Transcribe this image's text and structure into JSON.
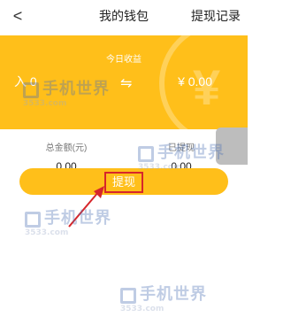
{
  "nav": {
    "back_icon": "chevron-left-icon",
    "back_glyph": "<",
    "title": "我的钱包",
    "right_link": "提现记录"
  },
  "earnings": {
    "today_label": "今日收益",
    "coins_in": "入 0",
    "exchange_glyph": "⇋",
    "cash_out": "¥ 0.00",
    "coin_glyph": "¥"
  },
  "totals": {
    "total_label": "总金额(元)",
    "total_value": "0.00",
    "withdrawn_label": "已提现",
    "withdrawn_value": "0.00"
  },
  "withdraw": {
    "button_label": "提现"
  },
  "watermark": {
    "main": "手机世界",
    "sub": "3533.com"
  },
  "colors": {
    "accent_yellow": "#ffbf1a",
    "annotation_red": "#d6262b"
  }
}
